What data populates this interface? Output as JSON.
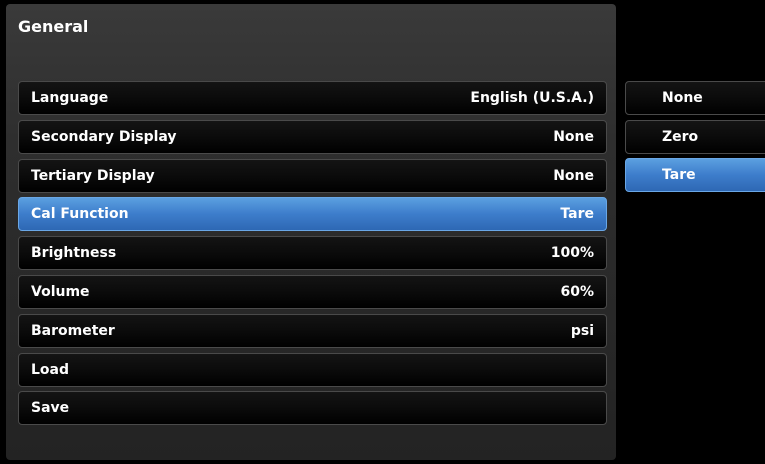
{
  "panel": {
    "title": "General"
  },
  "settings": [
    {
      "label": "Language",
      "value": "English (U.S.A.)"
    },
    {
      "label": "Secondary Display",
      "value": "None"
    },
    {
      "label": "Tertiary Display",
      "value": "None"
    },
    {
      "label": "Cal Function",
      "value": "Tare",
      "selected": true
    },
    {
      "label": "Brightness",
      "value": "100%"
    },
    {
      "label": "Volume",
      "value": "60%"
    },
    {
      "label": "Barometer",
      "value": "psi"
    },
    {
      "label": "Load",
      "value": ""
    },
    {
      "label": "Save",
      "value": ""
    }
  ],
  "options": [
    {
      "label": "None"
    },
    {
      "label": "Zero"
    },
    {
      "label": "Tare",
      "selected": true
    }
  ],
  "colors": {
    "background": "#000000",
    "panel": "#2e2e2e",
    "selected_accent": "#3d7dcb"
  }
}
